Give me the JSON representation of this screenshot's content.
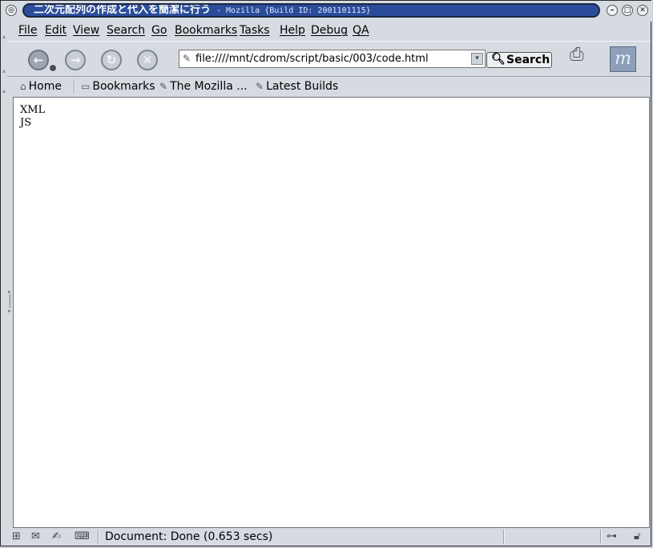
{
  "window": {
    "title": "二次元配列の作成と代入を簡潔に行う",
    "subtitle": "- Mozilla {Build ID: 2001101115}"
  },
  "menu": [
    "File",
    "Edit",
    "View",
    "Search",
    "Go",
    "Bookmarks",
    "Tasks",
    "Help",
    "Debug",
    "QA"
  ],
  "navigation": {
    "url": "file:////mnt/cdrom/script/basic/003/code.html",
    "search_label": "Search"
  },
  "personal_toolbar": {
    "home": "Home",
    "bookmarks": "Bookmarks",
    "mozilla": "The Mozilla ...",
    "latest": "Latest Builds"
  },
  "content": {
    "lines": [
      "XML",
      "JS"
    ]
  },
  "status": {
    "text": "Document: Done (0.653 secs)"
  }
}
